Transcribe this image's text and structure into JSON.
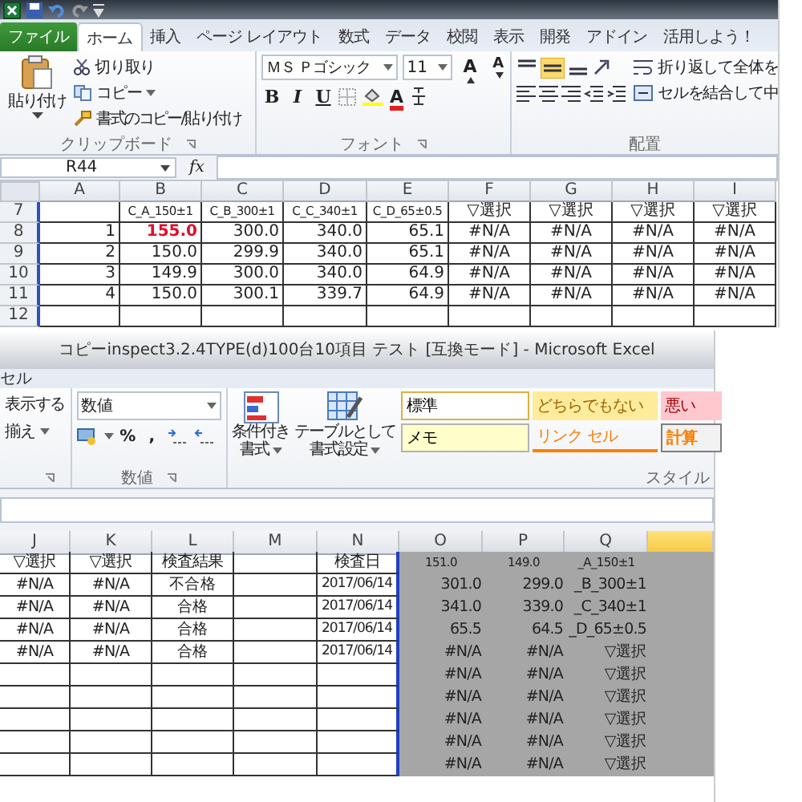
{
  "top_window": {
    "tabs": [
      {
        "label": "ファイル",
        "kind": "file",
        "selected": false
      },
      {
        "label": "ホーム",
        "kind": "tab",
        "selected": true
      },
      {
        "label": "挿入",
        "kind": "tab",
        "selected": false
      },
      {
        "label": "ページ レイアウト",
        "kind": "tab",
        "selected": false
      },
      {
        "label": "数式",
        "kind": "tab",
        "selected": false
      },
      {
        "label": "データ",
        "kind": "tab",
        "selected": false
      },
      {
        "label": "校閲",
        "kind": "tab",
        "selected": false
      },
      {
        "label": "表示",
        "kind": "tab",
        "selected": false
      },
      {
        "label": "開発",
        "kind": "tab",
        "selected": false
      },
      {
        "label": "アドイン",
        "kind": "tab",
        "selected": false
      },
      {
        "label": "活用しよう！",
        "kind": "tab",
        "selected": false
      }
    ],
    "clipboard": {
      "paste": "貼り付け",
      "cut": "切り取り",
      "copy": "コピー",
      "format_painter": "書式のコピー/貼り付け",
      "label": "クリップボード"
    },
    "font": {
      "name": "ＭＳ Ｐゴシック",
      "size": "11",
      "grow": "A",
      "shrink": "A",
      "styles": [
        "B",
        "I",
        "U"
      ],
      "font_color": "A",
      "label": "フォント"
    },
    "alignment": {
      "wrap": "折り返して全体を",
      "merge": "セルを結合して中",
      "label": "配置"
    },
    "formula_bar": {
      "name_box": "R44",
      "function_label": "fx"
    },
    "sheet": {
      "columns": [
        {
          "label": "A",
          "kind": "number",
          "selected": false
        },
        {
          "label": "B",
          "kind": "number",
          "selected": false
        },
        {
          "label": "C",
          "kind": "number",
          "selected": false
        },
        {
          "label": "D",
          "kind": "number",
          "selected": false
        },
        {
          "label": "E",
          "kind": "number",
          "selected": false
        },
        {
          "label": "F",
          "kind": "text",
          "selected": false
        },
        {
          "label": "G",
          "kind": "text",
          "selected": false
        },
        {
          "label": "H",
          "kind": "text",
          "selected": false
        },
        {
          "label": "I",
          "kind": "text",
          "selected": false
        }
      ],
      "rows": [
        {
          "header": "7",
          "kind": "labels",
          "cells": [
            null,
            "C_A_150±1",
            "C_B_300±1",
            "C_C_340±1",
            "C_D_65±0.5",
            "▽選択",
            "▽選択",
            "▽選択",
            "▽選択"
          ]
        },
        {
          "header": "8",
          "kind": "data",
          "cells": [
            "1",
            {
              "text": "155.0",
              "alert": true
            },
            "300.0",
            "340.0",
            "65.1",
            "#N/A",
            "#N/A",
            "#N/A",
            "#N/A"
          ]
        },
        {
          "header": "9",
          "kind": "data",
          "cells": [
            "2",
            "150.0",
            "299.9",
            "340.0",
            "65.1",
            "#N/A",
            "#N/A",
            "#N/A",
            "#N/A"
          ]
        },
        {
          "header": "10",
          "kind": "data",
          "cells": [
            "3",
            "149.9",
            "300.0",
            "340.0",
            "64.9",
            "#N/A",
            "#N/A",
            "#N/A",
            "#N/A"
          ]
        },
        {
          "header": "11",
          "kind": "data",
          "cells": [
            "4",
            "150.0",
            "300.1",
            "339.7",
            "64.9",
            "#N/A",
            "#N/A",
            "#N/A",
            "#N/A"
          ]
        },
        {
          "header": "12",
          "kind": "data",
          "cells": []
        }
      ]
    }
  },
  "bottom_window": {
    "title": "コピーinspect3.2.4TYPE(d)100台10項目  テスト  [互換モード] - Microsoft Excel",
    "tab_fragment": "セル",
    "alignment_fragment": {
      "show": "表示する",
      "align": "揃え"
    },
    "number": {
      "format": "数値",
      "percent": "%",
      "comma": ",",
      "label": "数値"
    },
    "styles": {
      "conditional": [
        "条件付き",
        "書式"
      ],
      "table": [
        "テーブルとして",
        "書式設定"
      ],
      "label": "スタイル",
      "gallery": [
        {
          "label": "標準",
          "kind": "normal"
        },
        {
          "label": "どちらでもない",
          "kind": "neutral"
        },
        {
          "label": "悪い",
          "kind": "bad"
        },
        {
          "label": "メモ",
          "kind": "note"
        },
        {
          "label": "リンク セル",
          "kind": "linked"
        },
        {
          "label": "計算",
          "kind": "calc"
        }
      ]
    },
    "sheet": {
      "columns": [
        {
          "label": "J",
          "kind": "text",
          "selected": false
        },
        {
          "label": "K",
          "kind": "text",
          "selected": false
        },
        {
          "label": "L",
          "kind": "text",
          "selected": false
        },
        {
          "label": "M",
          "kind": "text",
          "selected": false
        },
        {
          "label": "N",
          "kind": "text",
          "selected": false
        },
        {
          "label": "O",
          "kind": "number",
          "selected": true
        },
        {
          "label": "P",
          "kind": "number",
          "selected": true
        },
        {
          "label": "Q",
          "kind": "number",
          "selected": true
        }
      ],
      "rows": [
        {
          "kind": "labels",
          "cells": [
            "▽選択",
            "▽選択",
            "検査結果",
            null,
            "検査日",
            "151.0",
            "149.0",
            "_A_150±1"
          ]
        },
        {
          "kind": "data",
          "cells": [
            "#N/A",
            "#N/A",
            "不合格",
            null,
            "2017/06/14",
            "301.0",
            "299.0",
            "_B_300±1"
          ]
        },
        {
          "kind": "data",
          "cells": [
            "#N/A",
            "#N/A",
            "合格",
            null,
            "2017/06/14",
            "341.0",
            "339.0",
            "_C_340±1"
          ]
        },
        {
          "kind": "data",
          "cells": [
            "#N/A",
            "#N/A",
            "合格",
            null,
            "2017/06/14",
            "65.5",
            "64.5",
            "_D_65±0.5"
          ]
        },
        {
          "kind": "data",
          "cells": [
            "#N/A",
            "#N/A",
            "合格",
            null,
            "2017/06/14",
            "#N/A",
            "#N/A",
            "▽選択"
          ]
        },
        {
          "kind": "data",
          "cells": [
            null,
            null,
            null,
            null,
            null,
            "#N/A",
            "#N/A",
            "▽選択"
          ]
        },
        {
          "kind": "data",
          "cells": [
            null,
            null,
            null,
            null,
            null,
            "#N/A",
            "#N/A",
            "▽選択"
          ]
        },
        {
          "kind": "data",
          "cells": [
            null,
            null,
            null,
            null,
            null,
            "#N/A",
            "#N/A",
            "▽選択"
          ]
        },
        {
          "kind": "data",
          "cells": [
            null,
            null,
            null,
            null,
            null,
            "#N/A",
            "#N/A",
            "▽選択"
          ]
        },
        {
          "kind": "data",
          "cells": [
            null,
            null,
            null,
            null,
            null,
            "#N/A",
            "#N/A",
            "▽選択"
          ]
        }
      ]
    }
  }
}
